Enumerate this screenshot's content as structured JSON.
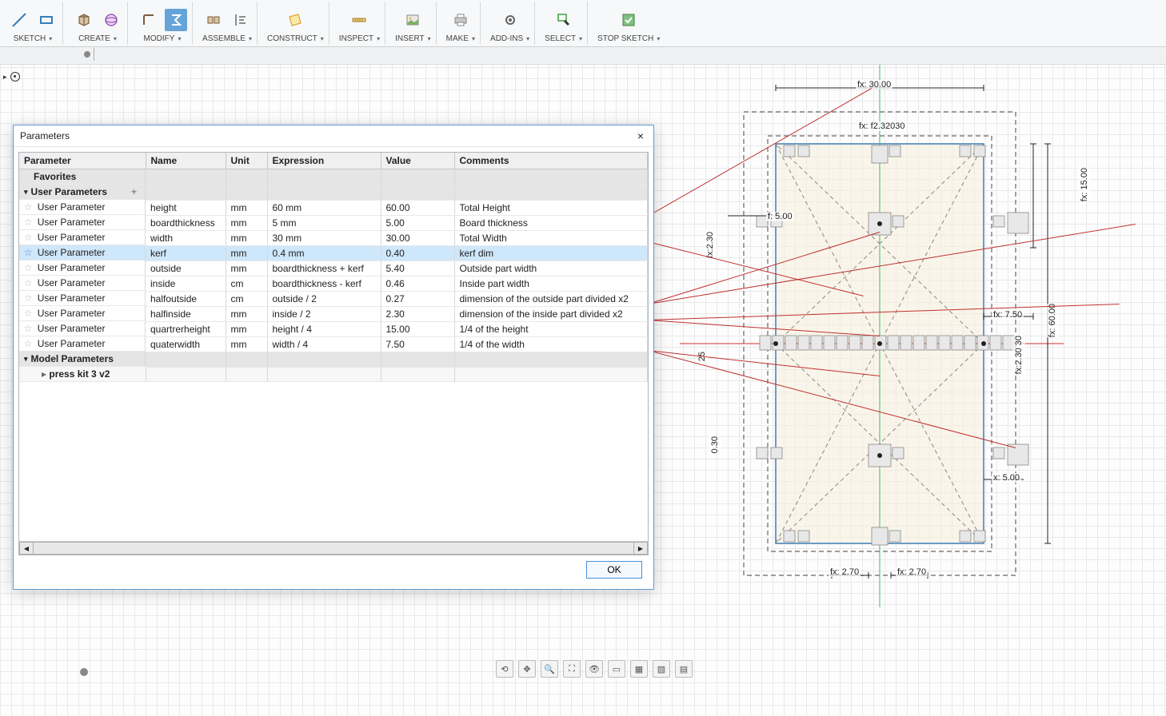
{
  "toolbar": {
    "groups": [
      {
        "label": "SKETCH"
      },
      {
        "label": "CREATE"
      },
      {
        "label": "MODIFY"
      },
      {
        "label": "ASSEMBLE"
      },
      {
        "label": "CONSTRUCT"
      },
      {
        "label": "INSPECT"
      },
      {
        "label": "INSERT"
      },
      {
        "label": "MAKE"
      },
      {
        "label": "ADD-INS"
      },
      {
        "label": "SELECT"
      },
      {
        "label": "STOP SKETCH"
      }
    ]
  },
  "dialog": {
    "title": "Parameters",
    "ok_label": "OK",
    "headers": {
      "parameter": "Parameter",
      "name": "Name",
      "unit": "Unit",
      "expression": "Expression",
      "value": "Value",
      "comments": "Comments"
    },
    "groups": {
      "favorites": "Favorites",
      "user_params": "User Parameters",
      "model_params": "Model Parameters",
      "model_child": "press kit 3 v2"
    },
    "rows": [
      {
        "param": "User Parameter",
        "name": "height",
        "unit": "mm",
        "expr": "60 mm",
        "value": "60.00",
        "comments": "Total Height",
        "selected": false
      },
      {
        "param": "User Parameter",
        "name": "boardthickness",
        "unit": "mm",
        "expr": "5 mm",
        "value": "5.00",
        "comments": "Board thickness",
        "selected": false
      },
      {
        "param": "User Parameter",
        "name": "width",
        "unit": "mm",
        "expr": "30 mm",
        "value": "30.00",
        "comments": "Total Width",
        "selected": false
      },
      {
        "param": "User Parameter",
        "name": "kerf",
        "unit": "mm",
        "expr": "0.4 mm",
        "value": "0.40",
        "comments": "kerf dim",
        "selected": true
      },
      {
        "param": "User Parameter",
        "name": "outside",
        "unit": "mm",
        "expr": "boardthickness + kerf",
        "value": "5.40",
        "comments": "Outside part width",
        "selected": false
      },
      {
        "param": "User Parameter",
        "name": "inside",
        "unit": "cm",
        "expr": "boardthickness - kerf",
        "value": "0.46",
        "comments": "Inside part width",
        "selected": false
      },
      {
        "param": "User Parameter",
        "name": "halfoutside",
        "unit": "cm",
        "expr": "outside / 2",
        "value": "0.27",
        "comments": "dimension of the outside part divided x2",
        "selected": false
      },
      {
        "param": "User Parameter",
        "name": "halfinside",
        "unit": "mm",
        "expr": "inside / 2",
        "value": "2.30",
        "comments": "dimension of the inside part divided x2",
        "selected": false
      },
      {
        "param": "User Parameter",
        "name": "quartrerheight",
        "unit": "mm",
        "expr": "height / 4",
        "value": "15.00",
        "comments": "1/4 of the height",
        "selected": false
      },
      {
        "param": "User Parameter",
        "name": "quaterwidth",
        "unit": "mm",
        "expr": "width / 4",
        "value": "7.50",
        "comments": "1/4 of the width",
        "selected": false
      }
    ]
  },
  "dims": {
    "d30": "fx: 30.00",
    "d230230": "fx: f2.32030",
    "d15": "fx: 15.00",
    "d5l": "f: 5.00",
    "d230l": "fx:2.30",
    "d750": "fx: 7.50",
    "d60": "fx: 60.00",
    "d25": "25",
    "d030v": "0.30",
    "d270l": "fx: 2.70",
    "d270r": "fx: 2.70",
    "d5r": "x: 5.00",
    "d230r": "fx:2.30 30"
  }
}
